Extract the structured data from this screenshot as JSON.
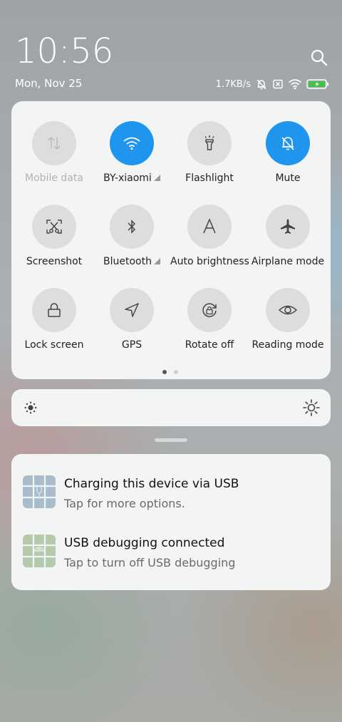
{
  "header": {
    "time": "10:56",
    "date": "Mon, Nov 25",
    "network_speed": "1.7KB/s"
  },
  "icons": {
    "search": "search-icon",
    "mute_status": "bell-off-icon",
    "sim": "no-sim-icon",
    "wifi": "wifi-icon",
    "battery": "battery-charging-icon"
  },
  "colors": {
    "accent": "#1f95ee",
    "tile_off": "#dcdddd",
    "panel": "#f3f4f4",
    "battery_fill": "#46c04a"
  },
  "quick_settings": {
    "tiles": [
      {
        "label": "Mobile data",
        "state": "disabled",
        "icon": "mobile-data-icon"
      },
      {
        "label": "BY-xiaomi",
        "state": "on",
        "icon": "wifi-icon",
        "expandable": true
      },
      {
        "label": "Flashlight",
        "state": "off",
        "icon": "flashlight-icon"
      },
      {
        "label": "Mute",
        "state": "on",
        "icon": "bell-off-icon"
      },
      {
        "label": "Screenshot",
        "state": "off",
        "icon": "screenshot-icon"
      },
      {
        "label": "Bluetooth",
        "state": "off",
        "icon": "bluetooth-icon",
        "expandable": true
      },
      {
        "label": "Auto brightness",
        "state": "off",
        "icon": "auto-brightness-icon"
      },
      {
        "label": "Airplane mode",
        "state": "off",
        "icon": "airplane-icon"
      },
      {
        "label": "Lock screen",
        "state": "off",
        "icon": "lock-icon"
      },
      {
        "label": "GPS",
        "state": "off",
        "icon": "location-arrow-icon"
      },
      {
        "label": "Rotate off",
        "state": "off",
        "icon": "rotation-lock-icon"
      },
      {
        "label": "Reading mode",
        "state": "off",
        "icon": "eye-icon"
      }
    ],
    "page_count": 2,
    "current_page": 1
  },
  "brightness": {
    "low_icon": "brightness-low-icon",
    "high_icon": "brightness-high-icon",
    "level": 0
  },
  "notifications": [
    {
      "title": "Charging this device via USB",
      "body": "Tap for more options.",
      "icon": "usb-charging-app-icon"
    },
    {
      "title": "USB debugging connected",
      "body": "Tap to turn off USB debugging",
      "icon": "android-debug-app-icon"
    }
  ]
}
